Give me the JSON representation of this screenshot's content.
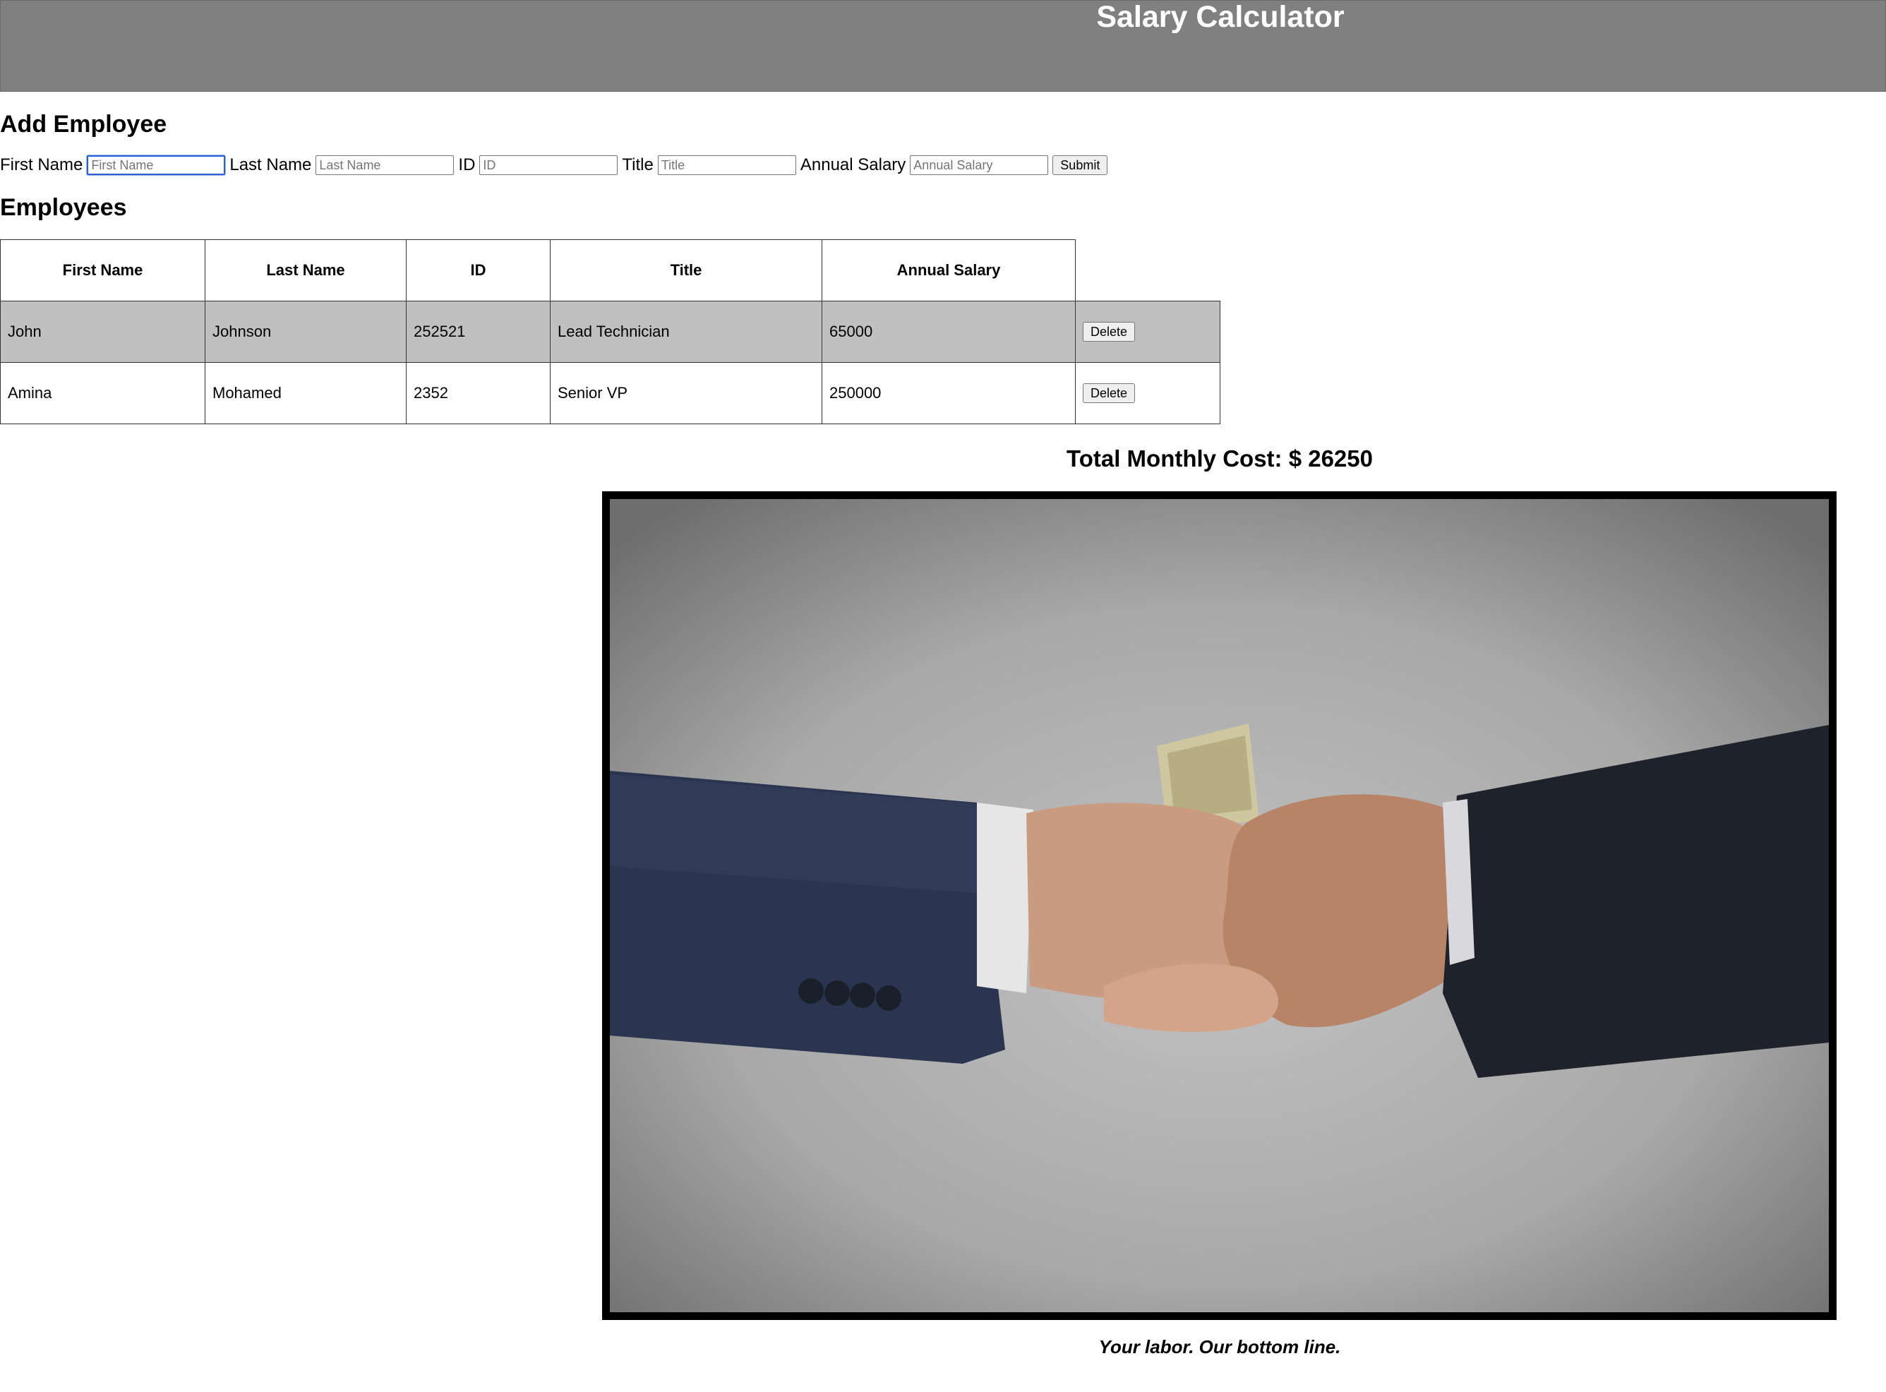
{
  "header": {
    "title": "Salary Calculator"
  },
  "add_employee": {
    "heading": "Add Employee",
    "fields": [
      {
        "label": "First Name",
        "placeholder": "First Name",
        "value": ""
      },
      {
        "label": "Last Name",
        "placeholder": "Last Name",
        "value": ""
      },
      {
        "label": "ID",
        "placeholder": "ID",
        "value": ""
      },
      {
        "label": "Title",
        "placeholder": "Title",
        "value": ""
      },
      {
        "label": "Annual Salary",
        "placeholder": "Annual Salary",
        "value": ""
      }
    ],
    "submit_label": "Submit"
  },
  "employees": {
    "heading": "Employees",
    "columns": [
      "First Name",
      "Last Name",
      "ID",
      "Title",
      "Annual Salary"
    ],
    "rows": [
      {
        "first_name": "John",
        "last_name": "Johnson",
        "id": "252521",
        "title": "Lead Technician",
        "salary": "65000",
        "action": "Delete"
      },
      {
        "first_name": "Amina",
        "last_name": "Mohamed",
        "id": "2352",
        "title": "Senior VP",
        "salary": "250000",
        "action": "Delete"
      }
    ]
  },
  "total": {
    "text": "Total Monthly Cost: $ 26250"
  },
  "colors": {
    "banner": "#808080",
    "highlight_row": "#c0c0c0",
    "focus_ring": "#2b5fd9"
  },
  "caption": "Your labor. Our bottom line."
}
